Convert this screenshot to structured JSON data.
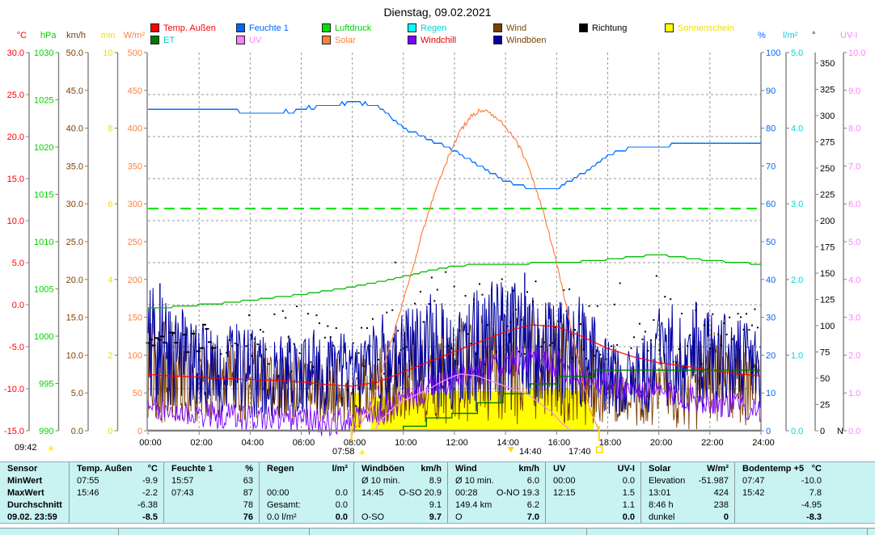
{
  "title": "Dienstag, 09.02.2021",
  "legend": {
    "rows": [
      [
        {
          "id": "temp-aussen",
          "label": "Temp. Außen",
          "swatch": "#ff0000",
          "text": "#ff0000"
        },
        {
          "id": "feuchte-1",
          "label": "Feuchte 1",
          "swatch": "#0066ff",
          "text": "#0066ff"
        },
        {
          "id": "luftdruck",
          "label": "Luftdruck",
          "swatch": "#00e000",
          "text": "#00d000"
        },
        {
          "id": "regen",
          "label": "Regen",
          "swatch": "#00ffff",
          "text": "#00d5d5"
        },
        {
          "id": "wind",
          "label": "Wind",
          "swatch": "#7b3f00",
          "text": "#7b3f00"
        },
        {
          "id": "richtung",
          "label": "Richtung",
          "swatch": "#000000",
          "text": "#000000"
        },
        {
          "id": "sonnenschein",
          "label": "Sonnenschein",
          "swatch": "#ffff00",
          "text": "#f0e000"
        }
      ],
      [
        {
          "id": "et",
          "label": "ET",
          "swatch": "#007800",
          "text": "#00cccc"
        },
        {
          "id": "uv",
          "label": "UV",
          "swatch": "#ff80ff",
          "text": "#ff80ff"
        },
        {
          "id": "solar",
          "label": "Solar",
          "swatch": "#ff8040",
          "text": "#ff8040"
        },
        {
          "id": "windchill",
          "label": "Windchill",
          "swatch": "#8000ff",
          "text": "#dd0000"
        },
        {
          "id": "windboeen",
          "label": "Windböen",
          "swatch": "#0000a0",
          "text": "#7b3f00"
        }
      ]
    ]
  },
  "sun_markers": {
    "daylength": "09:42",
    "sunrise": "07:58",
    "solar_max": "14:40",
    "sunset": "17:40",
    "sunrise_hour": 7.97,
    "sunset_hour": 17.66,
    "solar_max_hour": 14.4,
    "icon_color": "#ffd800"
  },
  "chart_data": {
    "type": "line",
    "x_ticks": [
      "00:00",
      "02:00",
      "04:00",
      "06:00",
      "08:00",
      "10:00",
      "12:00",
      "14:00",
      "16:00",
      "18:00",
      "20:00",
      "22:00",
      "24:00"
    ],
    "axes_left": [
      {
        "unit": "°C",
        "color": "#ff0000",
        "scale": "temp",
        "ticks": [
          "30.0",
          "25.0",
          "20.0",
          "15.0",
          "10.0",
          "5.0",
          "0.0",
          "-5.0",
          "-10.0",
          "-15.0"
        ]
      },
      {
        "unit": "hPa",
        "color": "#00d000",
        "scale": "hpa",
        "ticks": [
          "1030",
          "1025",
          "1020",
          "1015",
          "1010",
          "1005",
          "1000",
          "995",
          "990"
        ]
      },
      {
        "unit": "km/h",
        "color": "#7b3f00",
        "scale": "kmh",
        "ticks": [
          "50.0",
          "45.0",
          "40.0",
          "35.0",
          "30.0",
          "25.0",
          "20.0",
          "15.0",
          "10.0",
          "5.0",
          "0.0"
        ]
      },
      {
        "unit": "min",
        "color": "#f0e000",
        "scale": "min",
        "ticks": [
          "10",
          "8",
          "6",
          "4",
          "2",
          "0"
        ]
      },
      {
        "unit": "W/m²",
        "color": "#ff8040",
        "scale": "wm2",
        "ticks": [
          "500",
          "450",
          "400",
          "350",
          "300",
          "250",
          "200",
          "150",
          "100",
          "50",
          "0"
        ]
      }
    ],
    "axes_right": [
      {
        "unit": "%",
        "color": "#0066ff",
        "scale": "pct",
        "ticks": [
          "100",
          "90",
          "80",
          "70",
          "60",
          "50",
          "40",
          "30",
          "20",
          "10",
          "0"
        ]
      },
      {
        "unit": "l/m²",
        "color": "#00d5d5",
        "scale": "lm2",
        "ticks": [
          "5.0",
          "4.0",
          "3.0",
          "2.0",
          "1.0",
          "0.0"
        ]
      },
      {
        "unit": "°",
        "color": "#000000",
        "scale": "deg",
        "ticks": [
          "350",
          "325",
          "300",
          "275",
          "250",
          "225",
          "200",
          "175",
          "150",
          "125",
          "100",
          "75",
          "50",
          "25",
          "0"
        ],
        "zero_suffix": "N"
      },
      {
        "unit": "UV-I",
        "color": "#ff80ff",
        "scale": "uv",
        "ticks": [
          "10.0",
          "9.0",
          "8.0",
          "7.0",
          "6.0",
          "5.0",
          "4.0",
          "3.0",
          "2.0",
          "1.0",
          "0.0"
        ]
      }
    ],
    "grid": {
      "vertical_every_hours": 2,
      "horizontal_temp_lines": [
        25,
        20,
        15,
        10,
        5,
        0,
        -5,
        -10
      ],
      "color": "#999999"
    },
    "reference_lines": {
      "pressure_dashed_hpa": 1013.5,
      "color": "#00e600"
    },
    "series": {
      "temp_aussen_c": {
        "color": "#ff0000",
        "hourly": [
          -8.3,
          -8.5,
          -8.6,
          -8.8,
          -8.9,
          -9.0,
          -9.2,
          -9.5,
          -9.7,
          -9.2,
          -8.0,
          -6.8,
          -5.6,
          -4.4,
          -3.2,
          -2.4,
          -2.6,
          -3.8,
          -5.2,
          -6.2,
          -6.9,
          -7.3,
          -7.8,
          -8.2,
          -8.5
        ]
      },
      "feuchte1_pct": {
        "color": "#0070ff",
        "hourly": [
          85,
          85,
          85,
          85,
          84,
          84,
          85,
          86,
          87,
          86,
          80,
          77,
          74,
          70,
          66,
          64,
          64,
          68,
          73,
          75,
          75,
          76,
          76,
          76,
          76
        ]
      },
      "luftdruck_hpa": {
        "color": "#00bb00",
        "hourly": [
          1002.9,
          1003.1,
          1003.3,
          1003.5,
          1003.8,
          1004.1,
          1004.4,
          1004.8,
          1005.2,
          1005.7,
          1006.3,
          1006.9,
          1007.4,
          1007.6,
          1007.6,
          1007.7,
          1007.8,
          1007.9,
          1008.1,
          1008.4,
          1008.6,
          1008.3,
          1008.0,
          1007.8,
          1007.6
        ]
      },
      "solar_wm2": {
        "color": "#ff8040",
        "points": [
          [
            0,
            0
          ],
          [
            7.9,
            0
          ],
          [
            8.3,
            8
          ],
          [
            8.7,
            30
          ],
          [
            9.0,
            60
          ],
          [
            9.4,
            105
          ],
          [
            9.8,
            150
          ],
          [
            10.2,
            195
          ],
          [
            10.6,
            245
          ],
          [
            11.0,
            290
          ],
          [
            11.4,
            330
          ],
          [
            11.8,
            365
          ],
          [
            12.2,
            395
          ],
          [
            12.6,
            414
          ],
          [
            13.0,
            424
          ],
          [
            13.4,
            420
          ],
          [
            13.8,
            408
          ],
          [
            14.2,
            392
          ],
          [
            14.6,
            372
          ],
          [
            15.0,
            340
          ],
          [
            15.4,
            298
          ],
          [
            15.8,
            248
          ],
          [
            16.2,
            192
          ],
          [
            16.6,
            130
          ],
          [
            17.0,
            68
          ],
          [
            17.3,
            28
          ],
          [
            17.66,
            0
          ],
          [
            24,
            0
          ]
        ]
      },
      "sonnenschein_min": {
        "color": "#ffff00",
        "steps": [
          [
            0,
            0
          ],
          [
            7.98,
            0
          ],
          [
            7.98,
            1.0
          ],
          [
            8.36,
            1.0
          ],
          [
            8.36,
            0
          ],
          [
            8.72,
            0
          ],
          [
            8.72,
            0.9
          ],
          [
            10.5,
            0.9
          ],
          [
            10.5,
            1.0
          ],
          [
            12.0,
            1.0
          ],
          [
            12.0,
            1.05
          ],
          [
            14.9,
            1.05
          ],
          [
            14.9,
            1.1
          ],
          [
            16.5,
            1.1
          ],
          [
            16.5,
            1.05
          ],
          [
            17.2,
            1.05
          ],
          [
            17.2,
            0.6
          ],
          [
            17.45,
            0.6
          ],
          [
            17.45,
            0
          ],
          [
            24,
            0
          ]
        ]
      },
      "et_lm2": {
        "color": "#007800",
        "steps": [
          [
            0,
            0
          ],
          [
            10.0,
            0
          ],
          [
            10.0,
            0.06
          ],
          [
            10.9,
            0.06
          ],
          [
            10.9,
            0.17
          ],
          [
            11.9,
            0.17
          ],
          [
            11.9,
            0.23
          ],
          [
            12.9,
            0.23
          ],
          [
            12.9,
            0.37
          ],
          [
            13.9,
            0.37
          ],
          [
            13.9,
            0.49
          ],
          [
            14.95,
            0.49
          ],
          [
            14.95,
            0.62
          ],
          [
            16.1,
            0.62
          ],
          [
            16.1,
            0.72
          ],
          [
            17.5,
            0.72
          ],
          [
            17.5,
            0.8
          ],
          [
            24,
            0.8
          ]
        ]
      },
      "uv_index": {
        "color": "#ff85ff",
        "steps": [
          [
            0,
            0
          ],
          [
            8.9,
            0
          ],
          [
            9.0,
            0.2
          ],
          [
            9.3,
            0.4
          ],
          [
            9.6,
            0.6
          ],
          [
            10.0,
            0.8
          ],
          [
            10.5,
            0.95
          ],
          [
            11.0,
            1.1
          ],
          [
            11.5,
            1.3
          ],
          [
            12.0,
            1.45
          ],
          [
            12.25,
            1.5
          ],
          [
            12.9,
            1.45
          ],
          [
            13.3,
            1.35
          ],
          [
            13.7,
            1.25
          ],
          [
            14.1,
            1.15
          ],
          [
            14.5,
            1.05
          ],
          [
            14.9,
            0.95
          ],
          [
            15.2,
            0.8
          ],
          [
            15.5,
            0.65
          ],
          [
            15.8,
            0.5
          ],
          [
            16.0,
            0.35
          ],
          [
            16.2,
            0.2
          ],
          [
            16.4,
            0.1
          ],
          [
            16.5,
            0
          ],
          [
            24,
            0
          ]
        ]
      },
      "wind_kmh": {
        "color": "#7b3f00",
        "hourly_mean": [
          9,
          7,
          6,
          6,
          6,
          5.5,
          5.5,
          5,
          5,
          6,
          7,
          7.5,
          7,
          7.5,
          8.5,
          8,
          7.5,
          7,
          5,
          4.5,
          5,
          5.5,
          6,
          6,
          6
        ],
        "hourly_amp": [
          8,
          6,
          5,
          5,
          5,
          4.5,
          4.5,
          4,
          4,
          5,
          6,
          6.5,
          6.5,
          7,
          8,
          7,
          7,
          6.5,
          4,
          4,
          5,
          5.5,
          6,
          5.5,
          5
        ],
        "spikes": [
          [
            0.47,
            19.3
          ]
        ]
      },
      "windboeen_kmh": {
        "color": "#0000a0",
        "hourly_mean": [
          12,
          10,
          8.5,
          8,
          7.5,
          7,
          7.5,
          7,
          7,
          8.5,
          9.5,
          10,
          9.5,
          10,
          11.5,
          10.5,
          10,
          10.5,
          7,
          6.5,
          8.5,
          9.5,
          10,
          9,
          8.5
        ],
        "hourly_amp": [
          8,
          7,
          6,
          6,
          6,
          5.5,
          5.5,
          5,
          5,
          6,
          6.5,
          7,
          7,
          7.5,
          9,
          7.5,
          7,
          7.5,
          5,
          4.5,
          6.5,
          7,
          7,
          6,
          5.5
        ],
        "spikes": [
          [
            0.47,
            19.5
          ],
          [
            14.75,
            20.9
          ]
        ]
      },
      "windchill_c": {
        "color": "#7d00ff",
        "amp": 1.7,
        "hourly": [
          -12.5,
          -12.8,
          -13.0,
          -13.2,
          -13.4,
          -13.5,
          -13.7,
          -14.0,
          -13.8,
          -13.0,
          -11.5,
          -10.0,
          -9.0,
          -8.0,
          -7.0,
          -6.5,
          -7.0,
          -8.5,
          -9.5,
          -10.0,
          -10.5,
          -11.0,
          -11.5,
          -12.0,
          -12.3
        ]
      },
      "richtung_deg": {
        "color": "#000000",
        "hourly_center": [
          85,
          86,
          86,
          88,
          90,
          85,
          80,
          76,
          72,
          90,
          108,
          100,
          95,
          105,
          115,
          118,
          110,
          100,
          96,
          120,
          110,
          85,
          88,
          92,
          95
        ],
        "hourly_spread": [
          6,
          8,
          14,
          20,
          26,
          30,
          40,
          45,
          50,
          60,
          60,
          55,
          60,
          55,
          50,
          45,
          40,
          38,
          34,
          45,
          40,
          35,
          30,
          26,
          22
        ]
      },
      "regen_lm2": {
        "color": "#00e5e5",
        "hourly": [
          0,
          0,
          0,
          0,
          0,
          0,
          0,
          0,
          0,
          0,
          0,
          0,
          0,
          0,
          0,
          0,
          0,
          0,
          0,
          0,
          0,
          0,
          0,
          0,
          0
        ]
      }
    }
  },
  "table": {
    "row_labels": [
      "Sensor",
      "MinWert",
      "MaxWert",
      "Durchschnitt",
      "09.02. 23:59"
    ],
    "columns": [
      {
        "name": "Temp. Außen",
        "unit": "°C",
        "rows": [
          [
            "07:55",
            "-9.9"
          ],
          [
            "15:46",
            "-2.2"
          ],
          [
            "",
            "-6.38"
          ],
          [
            "",
            "-8.5"
          ]
        ]
      },
      {
        "name": "Feuchte 1",
        "unit": "%",
        "rows": [
          [
            "15:57",
            "63"
          ],
          [
            "07:43",
            "87"
          ],
          [
            "",
            "78"
          ],
          [
            "",
            "76"
          ]
        ]
      },
      {
        "name": "Regen",
        "unit": "l/m²",
        "rows": [
          [
            "",
            ""
          ],
          [
            "00:00",
            "0.0"
          ],
          [
            "Gesamt:",
            "0.0"
          ],
          [
            "0.0 l/m²",
            "0.0"
          ]
        ]
      },
      {
        "name": "Windböen",
        "unit": "km/h",
        "rows": [
          [
            "Ø 10 min.",
            "8.9"
          ],
          [
            "14:45",
            "O-SO 20.9"
          ],
          [
            "",
            "9.1"
          ],
          [
            "O-SO",
            "9.7"
          ]
        ]
      },
      {
        "name": "Wind",
        "unit": "km/h",
        "rows": [
          [
            "Ø 10 min.",
            "6.0"
          ],
          [
            "00:28",
            "O-NO 19.3"
          ],
          [
            "149.4 km",
            "6.2"
          ],
          [
            "O",
            "7.0"
          ]
        ]
      },
      {
        "name": "UV",
        "unit": "UV-I",
        "rows": [
          [
            "00:00",
            "0.0"
          ],
          [
            "12:15",
            "1.5"
          ],
          [
            "",
            "1.1"
          ],
          [
            "",
            "0.0"
          ]
        ]
      },
      {
        "name": "Solar",
        "unit": "W/m²",
        "rows": [
          [
            "Elevation",
            "-51.987"
          ],
          [
            "13:01",
            "424"
          ],
          [
            "8:46 h",
            "238"
          ],
          [
            "dunkel",
            "0"
          ]
        ]
      },
      {
        "name": "Bodentemp +5",
        "unit": "°C",
        "rows": [
          [
            "07:47",
            "-10.0"
          ],
          [
            "15:42",
            "7.8"
          ],
          [
            "",
            "-4.95"
          ],
          [
            "",
            "-8.3"
          ]
        ]
      }
    ]
  }
}
